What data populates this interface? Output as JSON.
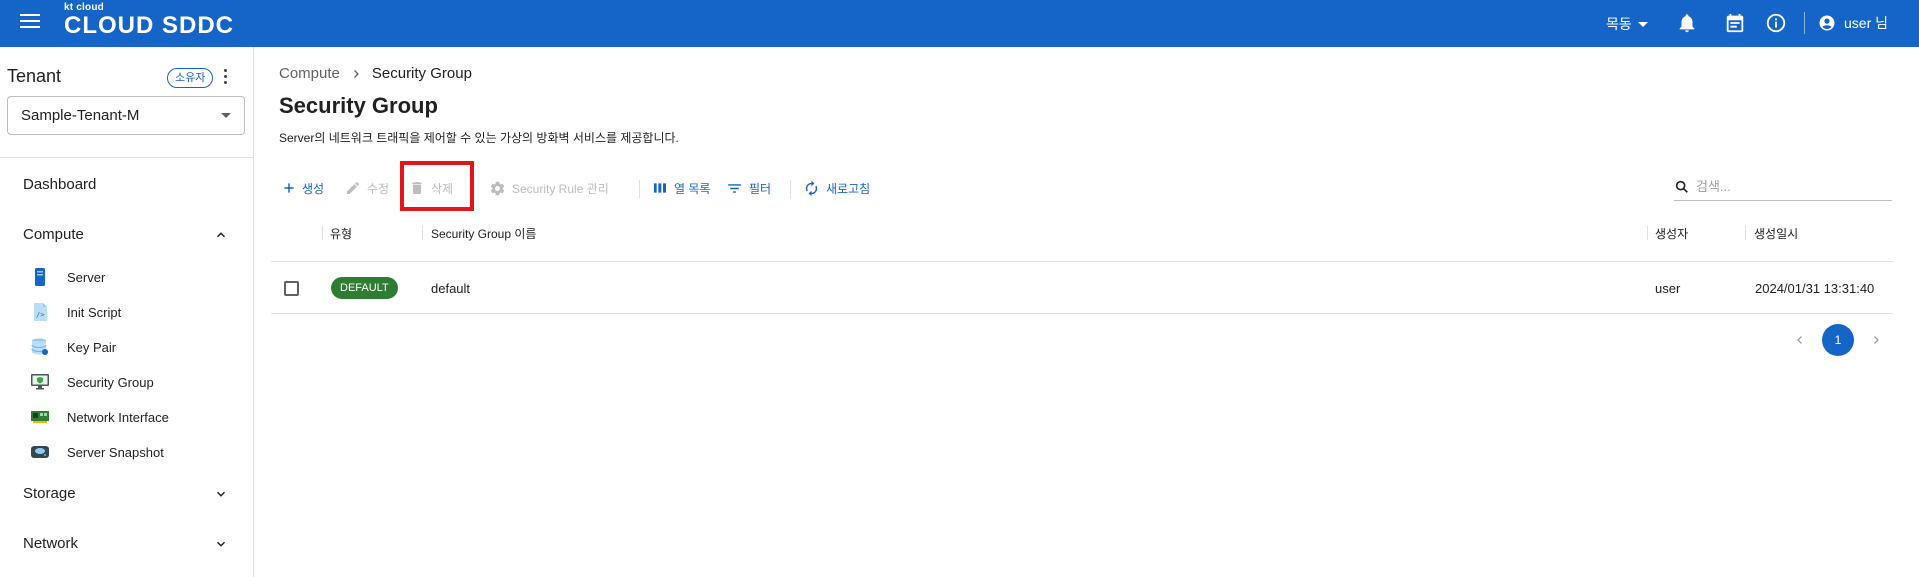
{
  "header": {
    "logo_small": "kt cloud",
    "logo_main": "CLOUD SDDC",
    "region": "목동",
    "user_label": "user 님",
    "brand_color": "#1565c8"
  },
  "sidebar": {
    "tenant_title": "Tenant",
    "owner_badge": "소유자",
    "tenant_selected": "Sample-Tenant-M",
    "dashboard": "Dashboard",
    "compute": "Compute",
    "compute_items": [
      {
        "label": "Server",
        "icon": "server-icon"
      },
      {
        "label": "Init Script",
        "icon": "script-icon"
      },
      {
        "label": "Key Pair",
        "icon": "database-icon"
      },
      {
        "label": "Security Group",
        "icon": "monitor-shield-icon"
      },
      {
        "label": "Network Interface",
        "icon": "nic-icon"
      },
      {
        "label": "Server Snapshot",
        "icon": "disk-icon"
      }
    ],
    "storage": "Storage",
    "network": "Network"
  },
  "main": {
    "breadcrumb_parent": "Compute",
    "breadcrumb_current": "Security Group",
    "title": "Security Group",
    "description": "Server의 네트워크 트래픽을 제어할 수 있는 가상의 방화벽 서비스를 제공합니다."
  },
  "toolbar": {
    "create": "생성",
    "edit": "수정",
    "delete": "삭제",
    "rule_manage": "Security Rule 관리",
    "columns": "열 목록",
    "filter": "필터",
    "refresh": "새로고침",
    "search_placeholder": "검색..."
  },
  "table": {
    "headers": {
      "type": "유형",
      "name": "Security Group 이름",
      "creator": "생성자",
      "created_at": "생성일시"
    },
    "rows": [
      {
        "type": "DEFAULT",
        "name": "default",
        "creator": "user",
        "created_at": "2024/01/31 13:31:40"
      }
    ]
  },
  "pagination": {
    "current_page": "1"
  }
}
